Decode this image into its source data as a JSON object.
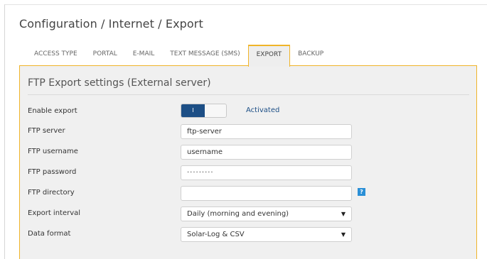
{
  "breadcrumb": "Configuration / Internet / Export",
  "tabs": [
    {
      "label": "ACCESS TYPE"
    },
    {
      "label": "PORTAL"
    },
    {
      "label": "E-MAIL"
    },
    {
      "label": "TEXT MESSAGE (SMS)"
    },
    {
      "label": "EXPORT",
      "active": true
    },
    {
      "label": "BACKUP"
    }
  ],
  "panel": {
    "title": "FTP Export settings (External server)",
    "enable_export": {
      "label": "Enable export",
      "toggle_text": "I",
      "status": "Activated"
    },
    "ftp_server": {
      "label": "FTP server",
      "value": "ftp-server"
    },
    "ftp_username": {
      "label": "FTP username",
      "value": "username"
    },
    "ftp_password": {
      "label": "FTP password",
      "value": "·········"
    },
    "ftp_directory": {
      "label": "FTP directory",
      "value": "",
      "help": "?"
    },
    "export_interval": {
      "label": "Export interval",
      "value": "Daily (morning and evening)",
      "caret": "▼"
    },
    "data_format": {
      "label": "Data format",
      "value": "Solar-Log & CSV",
      "caret": "▼"
    }
  },
  "colors": {
    "accent": "#f0b429",
    "toggle": "#1d4f86",
    "help": "#2a8fd6"
  }
}
